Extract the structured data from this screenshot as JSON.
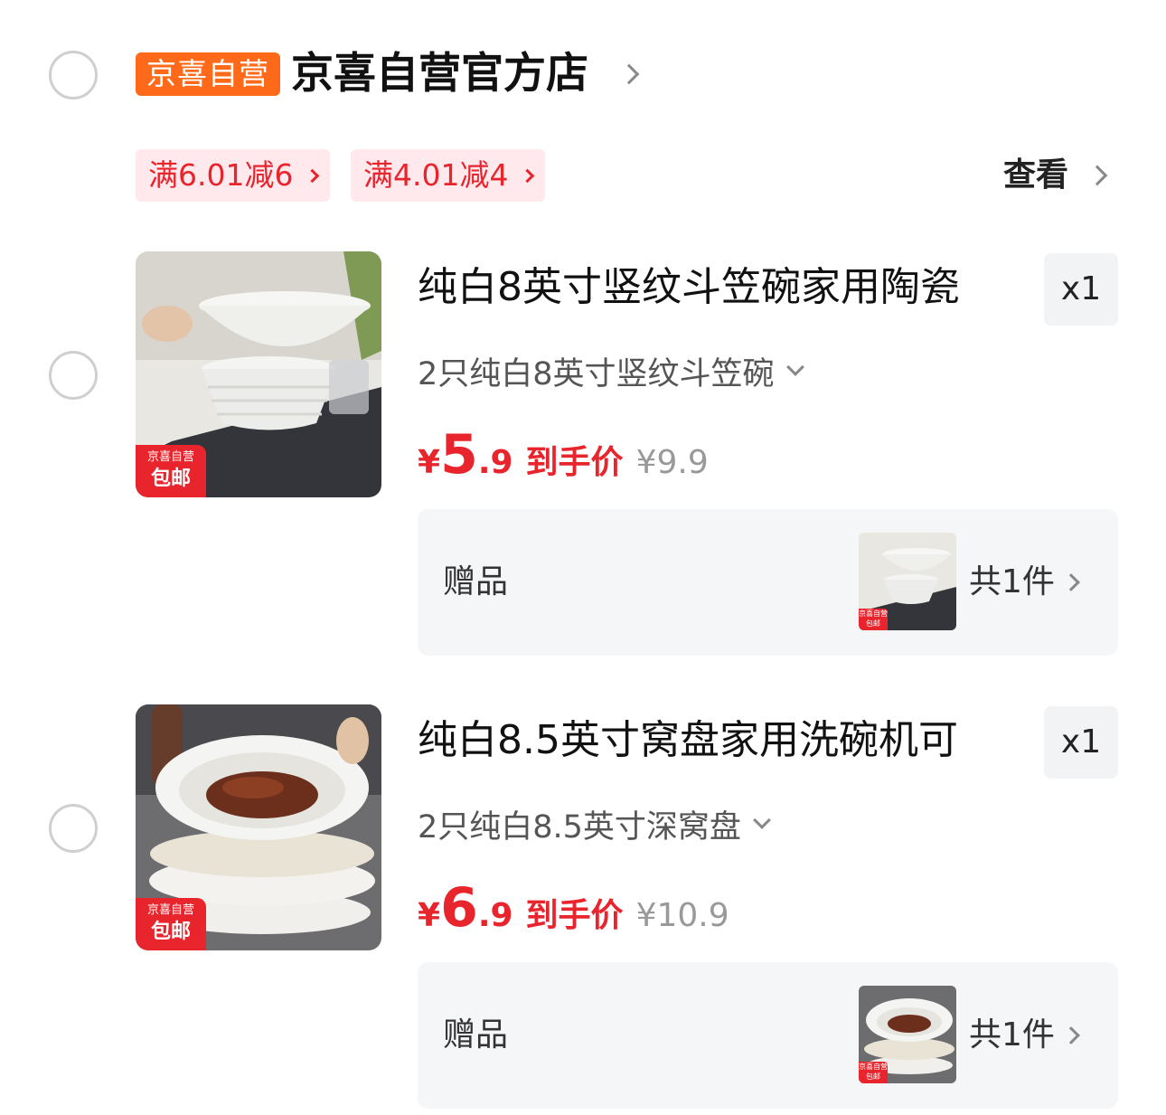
{
  "store": {
    "badge": "京喜自营",
    "name": "京喜自营官方店"
  },
  "coupons": [
    {
      "label": "满6.01减6"
    },
    {
      "label": "满4.01减4"
    }
  ],
  "view_label": "查看",
  "products": [
    {
      "title": "纯白8英寸竖纹斗笠碗家用陶瓷",
      "quantity": "x1",
      "spec": "2只纯白8英寸竖纹斗笠碗",
      "price_currency": "¥",
      "price_int": "5",
      "price_dec": ".9",
      "price_label": "到手价",
      "original_price": "¥9.9",
      "thumb_tag_top": "京喜自营",
      "thumb_tag_bottom": "包邮",
      "gift_label": "赠品",
      "gift_count": "共1件",
      "gift_tag": "京喜自营 包邮"
    },
    {
      "title": "纯白8.5英寸窝盘家用洗碗机可",
      "quantity": "x1",
      "spec": "2只纯白8.5英寸深窝盘",
      "price_currency": "¥",
      "price_int": "6",
      "price_dec": ".9",
      "price_label": "到手价",
      "original_price": "¥10.9",
      "thumb_tag_top": "京喜自营",
      "thumb_tag_bottom": "包邮",
      "gift_label": "赠品",
      "gift_count": "共1件",
      "gift_tag": "京喜自营 包邮"
    }
  ],
  "colors": {
    "accent_red": "#e8242c",
    "store_badge": "#ff6a1a",
    "coupon_bg": "#ffe9ec"
  }
}
